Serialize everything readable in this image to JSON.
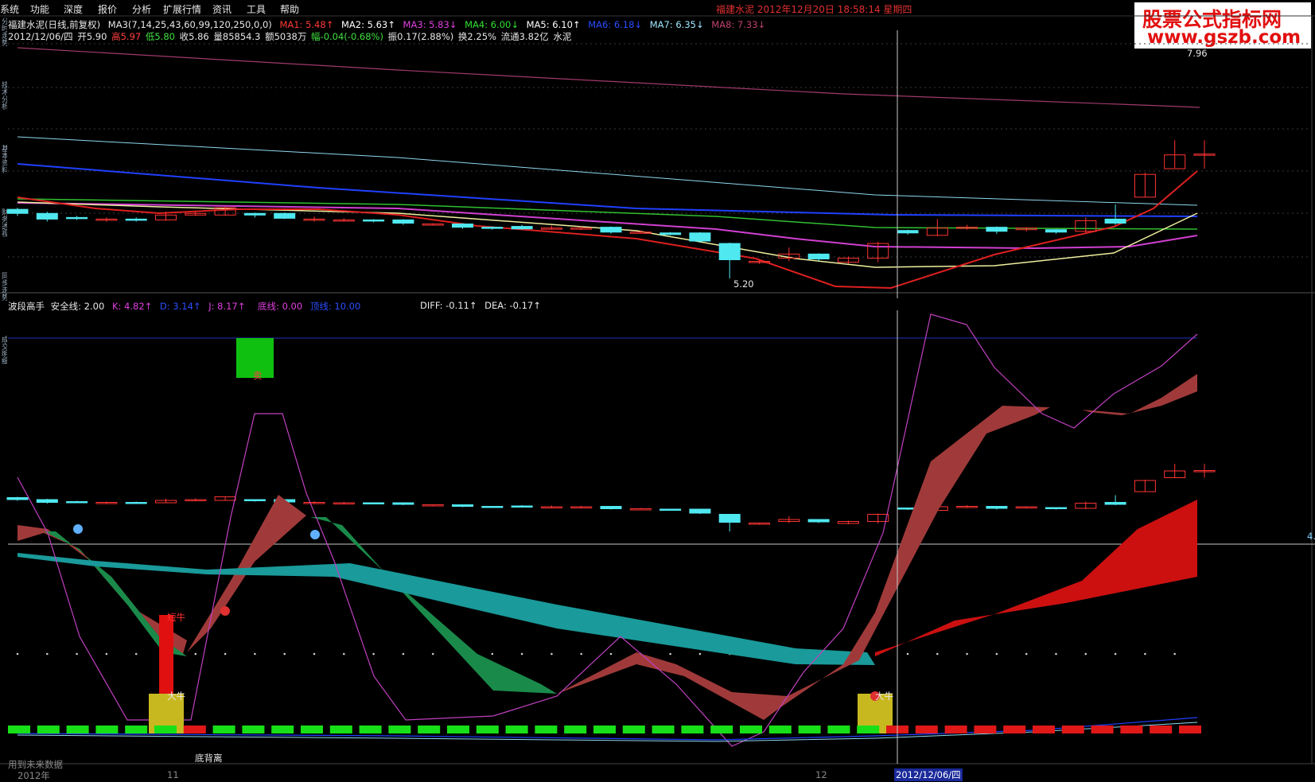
{
  "menu": [
    "系统",
    "功能",
    "深度",
    "报价",
    "分析",
    "扩展行情",
    "资讯",
    "工具",
    "帮助"
  ],
  "window_title": "福建水泥 2012年12月20日 18:58:14 星期四",
  "logo": {
    "line1": "股票公式指标网",
    "line2": "www.gszb.com"
  },
  "side_labels": [
    "分时走势",
    "技术分析",
    "基本资料",
    "财务透视",
    "同步走势",
    "成交明细"
  ],
  "main_panel": {
    "stock": "福建水泥(日线,前复权)",
    "ma_params": "MA3(7,14,25,43,60,99,120,250,0,0)",
    "mas": [
      {
        "label": "MA1: 5.48↑",
        "color": "#ff3a3a"
      },
      {
        "label": "MA2: 5.63↑",
        "color": "#ffffff"
      },
      {
        "label": "MA3: 5.83↓",
        "color": "#e040e0"
      },
      {
        "label": "MA4: 6.00↓",
        "color": "#30e030"
      },
      {
        "label": "MA5: 6.10↑",
        "color": "#ffffff"
      },
      {
        "label": "MA6: 6.18↓",
        "color": "#2a4dff"
      },
      {
        "label": "MA7: 6.35↓",
        "color": "#9fe8ff"
      },
      {
        "label": "MA8: 7.33↓",
        "color": "#c04070"
      }
    ],
    "info_date": "2012/12/06/四",
    "info_open": "开5.90",
    "info_high": "高5.97",
    "info_low": "低5.80",
    "info_close": "收5.86",
    "info_vol": "量85854.3",
    "info_amount": "额5038万",
    "info_change": "幅-0.04(-0.68%)",
    "info_amp": "振0.17(2.88%)",
    "info_turnover": "换2.25%",
    "info_float": "流通3.82亿",
    "info_sector": "水泥",
    "high_mark": "7.96",
    "low_mark": "5.20"
  },
  "sub_panel": {
    "name": "波段高手",
    "safe_line": "安全线: 2.00",
    "k": "K: 4.82↑",
    "d": "D: 3.14↑",
    "j": "J: 8.17↑",
    "bottom_line": "底线: 0.00",
    "top_line": "顶线: 10.00",
    "diff": "DIFF: -0.11↑",
    "dea": "DEA: -0.17↑",
    "sell_mark": "卖",
    "bull1": "短牛",
    "bull2": "大牛",
    "bull3": "大牛",
    "divergence": "底背离",
    "right_axis": "4.",
    "future_note": "用到未来数据"
  },
  "footer": {
    "year": "2012年",
    "month11": "11",
    "month12": "12",
    "cursor_date": "2012/12/06/四"
  },
  "colors": {
    "up": "#ff3333",
    "down": "#4fe8f0",
    "green": "#1a8a4a",
    "teal": "#1a9a9a",
    "red": "#cc1010"
  },
  "chart_data": {
    "type": "candlestick",
    "candles": [
      [
        6.05,
        6.0,
        6.07,
        5.97
      ],
      [
        6.0,
        5.93,
        6.02,
        5.9
      ],
      [
        5.95,
        5.94,
        5.97,
        5.92
      ],
      [
        5.92,
        5.93,
        5.95,
        5.9
      ],
      [
        5.93,
        5.92,
        5.95,
        5.9
      ],
      [
        5.92,
        5.98,
        6.02,
        5.91
      ],
      [
        5.98,
        6.0,
        6.03,
        5.97
      ],
      [
        5.98,
        6.07,
        6.08,
        5.97
      ],
      [
        6.0,
        5.98,
        6.01,
        5.95
      ],
      [
        6.0,
        5.94,
        6.01,
        5.93
      ],
      [
        5.93,
        5.93,
        5.96,
        5.9
      ],
      [
        5.91,
        5.92,
        5.94,
        5.9
      ],
      [
        5.92,
        5.91,
        5.93,
        5.89
      ],
      [
        5.92,
        5.88,
        5.93,
        5.86
      ],
      [
        5.87,
        5.87,
        5.88,
        5.85
      ],
      [
        5.87,
        5.83,
        5.88,
        5.81
      ],
      [
        5.83,
        5.82,
        5.84,
        5.8
      ],
      [
        5.84,
        5.81,
        5.86,
        5.8
      ],
      [
        5.81,
        5.82,
        5.85,
        5.8
      ],
      [
        5.82,
        5.82,
        5.84,
        5.8
      ],
      [
        5.83,
        5.77,
        5.84,
        5.75
      ],
      [
        5.77,
        5.77,
        5.79,
        5.76
      ],
      [
        5.76,
        5.74,
        5.77,
        5.73
      ],
      [
        5.76,
        5.66,
        5.77,
        5.64
      ],
      [
        5.63,
        5.43,
        5.64,
        5.2
      ],
      [
        5.4,
        5.41,
        5.42,
        5.38
      ],
      [
        5.45,
        5.5,
        5.58,
        5.41
      ],
      [
        5.5,
        5.44,
        5.51,
        5.41
      ],
      [
        5.4,
        5.45,
        5.47,
        5.38
      ],
      [
        5.45,
        5.63,
        5.65,
        5.4
      ],
      [
        5.79,
        5.76,
        5.8,
        5.74
      ],
      [
        5.73,
        5.82,
        5.93,
        5.72
      ],
      [
        5.82,
        5.83,
        5.86,
        5.8
      ],
      [
        5.83,
        5.78,
        5.84,
        5.75
      ],
      [
        5.8,
        5.82,
        5.83,
        5.78
      ],
      [
        5.8,
        5.77,
        5.81,
        5.75
      ],
      [
        5.78,
        5.91,
        5.95,
        5.76
      ],
      [
        5.93,
        5.88,
        6.11,
        5.86
      ],
      [
        6.2,
        6.48,
        6.5,
        6.2
      ],
      [
        6.55,
        6.72,
        6.9,
        6.56
      ],
      [
        6.72,
        6.73,
        6.9,
        6.55
      ]
    ]
  }
}
